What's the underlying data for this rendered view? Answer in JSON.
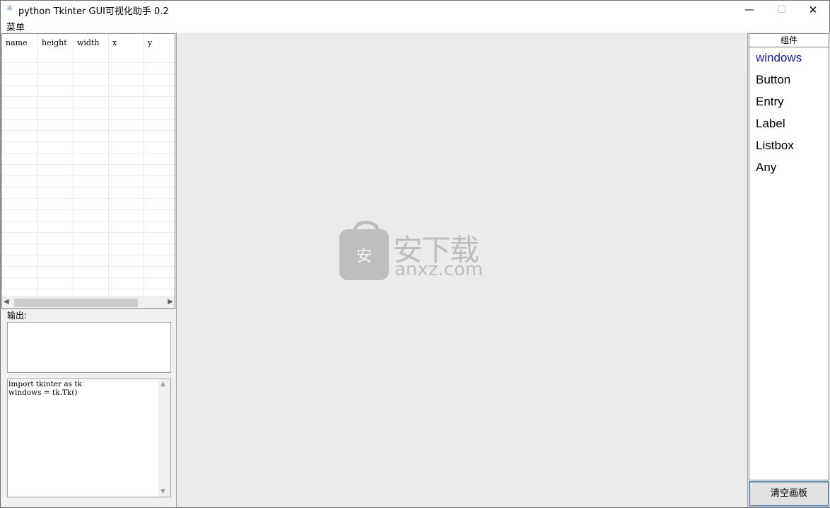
{
  "window": {
    "title": "python Tkinter GUI可视化助手 0.2",
    "icon": "feather-icon",
    "controls": {
      "minimize": "—",
      "maximize": "☐",
      "close": "✕"
    }
  },
  "menubar": {
    "items": [
      "菜单"
    ]
  },
  "properties_table": {
    "columns": [
      "name",
      "height",
      "width",
      "x",
      "y"
    ],
    "rows": []
  },
  "output": {
    "label": "输出:",
    "value": ""
  },
  "code": {
    "text": "import tkinter as tk\nwindows = tk.Tk()"
  },
  "watermark": {
    "cn": "安下载",
    "en": "anxz.com",
    "glyph": "安"
  },
  "components": {
    "header": "组件",
    "items": [
      "windows",
      "Button",
      "Entry",
      "Label",
      "Listbox",
      "Any"
    ],
    "selected": "windows"
  },
  "clear_button": {
    "label": "清空画板"
  },
  "colors": {
    "selected_item": "#1a1aa6",
    "canvas_bg": "#ebebeb"
  }
}
